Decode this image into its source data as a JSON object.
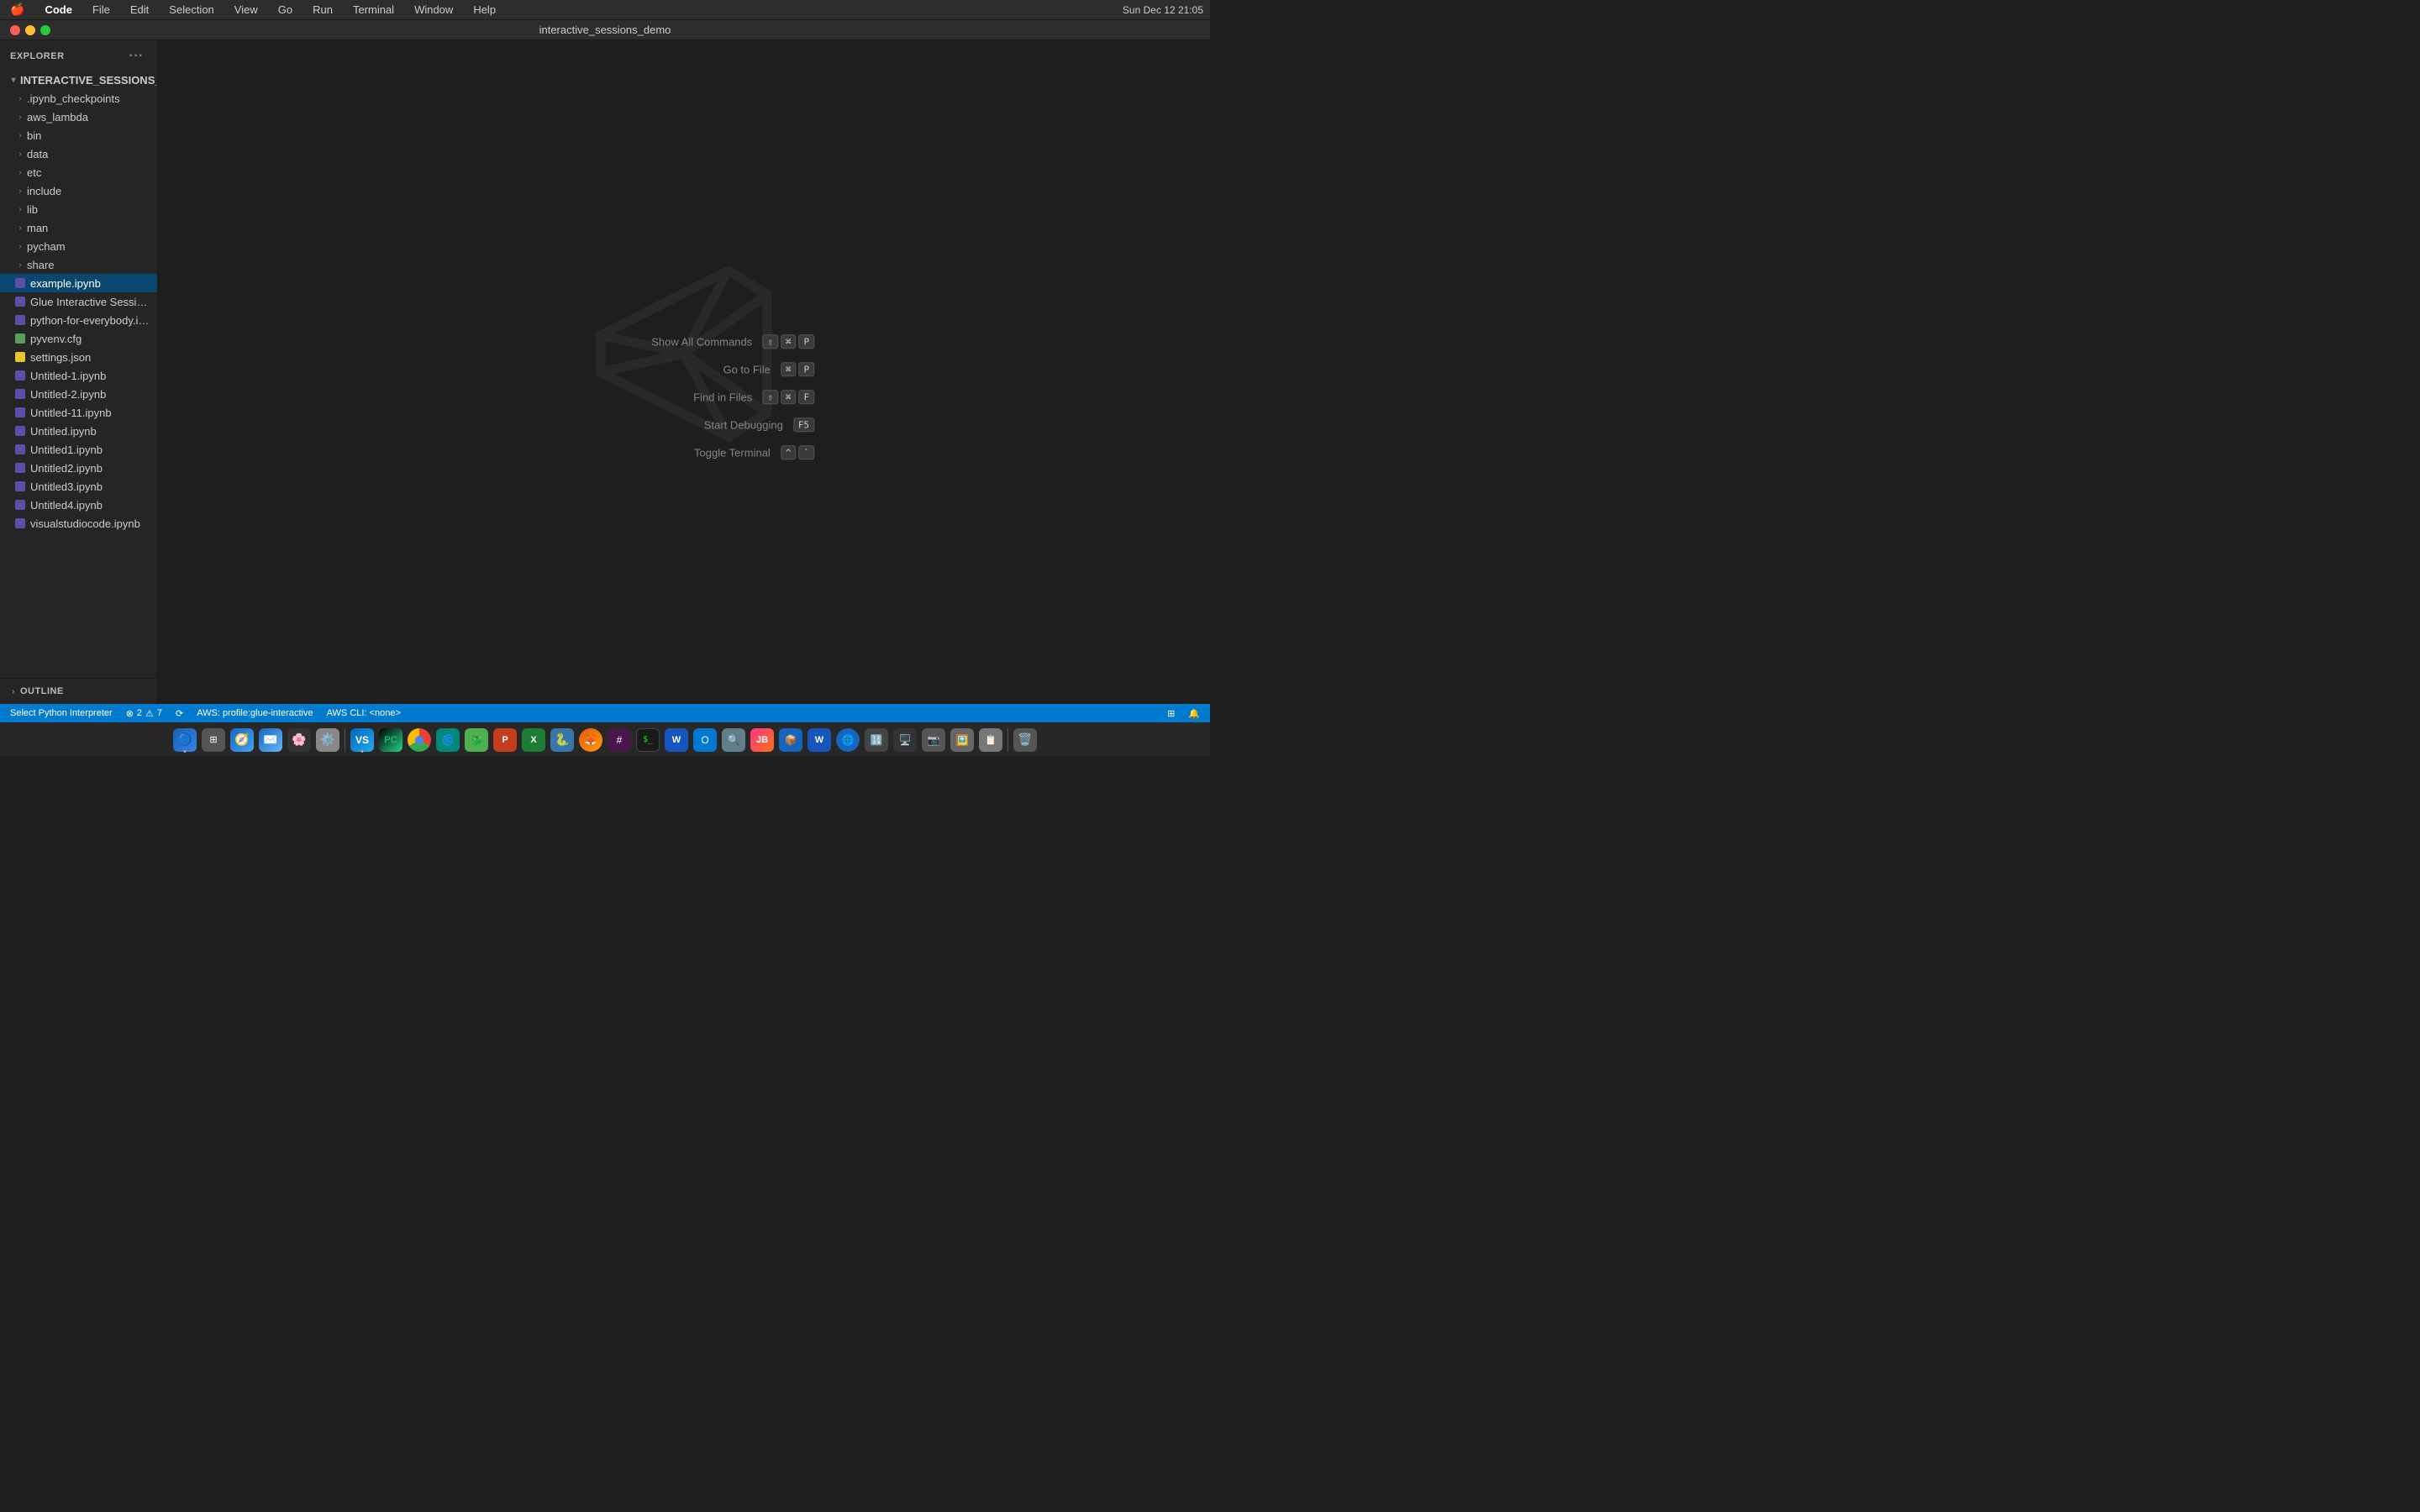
{
  "menubar": {
    "apple": "🍎",
    "items": [
      "Code",
      "File",
      "Edit",
      "Selection",
      "View",
      "Go",
      "Run",
      "Terminal",
      "Window",
      "Help"
    ],
    "time": "Sun Dec 12  21:05"
  },
  "titlebar": {
    "title": "interactive_sessions_demo"
  },
  "sidebar": {
    "header": "EXPLORER",
    "more_label": "···",
    "root": {
      "label": "INTERACTIVE_SESSIONS_DEMO",
      "expanded": true
    },
    "folders": [
      {
        "label": ".ipynb_checkpoints",
        "indent": 1
      },
      {
        "label": "aws_lambda",
        "indent": 1
      },
      {
        "label": "bin",
        "indent": 1
      },
      {
        "label": "data",
        "indent": 1
      },
      {
        "label": "etc",
        "indent": 1
      },
      {
        "label": "include",
        "indent": 1
      },
      {
        "label": "lib",
        "indent": 1
      },
      {
        "label": "man",
        "indent": 1
      },
      {
        "label": "pycham",
        "indent": 1
      },
      {
        "label": "share",
        "indent": 1
      }
    ],
    "files": [
      {
        "label": "example.ipynb",
        "type": "notebook",
        "active": true
      },
      {
        "label": "Glue Interactive Session.ipynb",
        "type": "notebook"
      },
      {
        "label": "python-for-everybody.ipynb",
        "type": "notebook"
      },
      {
        "label": "pyvenv.cfg",
        "type": "cfg"
      },
      {
        "label": "settings.json",
        "type": "json"
      },
      {
        "label": "Untitled-1.ipynb",
        "type": "notebook"
      },
      {
        "label": "Untitled-2.ipynb",
        "type": "notebook"
      },
      {
        "label": "Untitled-11.ipynb",
        "type": "notebook"
      },
      {
        "label": "Untitled.ipynb",
        "type": "notebook"
      },
      {
        "label": "Untitled1.ipynb",
        "type": "notebook"
      },
      {
        "label": "Untitled2.ipynb",
        "type": "notebook"
      },
      {
        "label": "Untitled3.ipynb",
        "type": "notebook"
      },
      {
        "label": "Untitled4.ipynb",
        "type": "notebook"
      },
      {
        "label": "visualstudiocode.ipynb",
        "type": "notebook"
      }
    ],
    "outline_label": "OUTLINE"
  },
  "commands": [
    {
      "label": "Show All Commands",
      "keys": [
        "⇧",
        "⌘",
        "P"
      ]
    },
    {
      "label": "Go to File",
      "keys": [
        "⌘",
        "P"
      ]
    },
    {
      "label": "Find in Files",
      "keys": [
        "⇧",
        "⌘",
        "F"
      ]
    },
    {
      "label": "Start Debugging",
      "keys": [
        "F5"
      ]
    },
    {
      "label": "Toggle Terminal",
      "keys": [
        "^",
        "`"
      ]
    }
  ],
  "statusbar": {
    "python_interpreter": "Select Python Interpreter",
    "errors": "2",
    "warnings": "7",
    "aws_profile": "AWS: profile:glue-interactive",
    "aws_cli": "AWS CLI: <none>",
    "branch_icon": "⎇"
  },
  "dock": {
    "items": [
      {
        "name": "finder",
        "emoji": "🟦",
        "color": "#1e7cf5"
      },
      {
        "name": "launchpad",
        "emoji": "🔲",
        "color": "#888"
      },
      {
        "name": "safari",
        "emoji": "🧭",
        "color": "#1e88e5"
      },
      {
        "name": "mail",
        "emoji": "✉️",
        "color": "#2196f3"
      },
      {
        "name": "photos",
        "emoji": "🖼️",
        "color": "#999"
      },
      {
        "name": "system-prefs",
        "emoji": "⚙️",
        "color": "#888"
      },
      {
        "name": "vscode",
        "emoji": "📘",
        "color": "#23a9f2"
      },
      {
        "name": "pycharm",
        "emoji": "🐍",
        "color": "#21d789"
      },
      {
        "name": "chrome",
        "emoji": "🟡",
        "color": "#fbbc04"
      },
      {
        "name": "unknown1",
        "emoji": "🔷",
        "color": "#2196f3"
      },
      {
        "name": "unknown2",
        "emoji": "🟩",
        "color": "#4caf50"
      },
      {
        "name": "powerpoint",
        "emoji": "📊",
        "color": "#d04b24"
      },
      {
        "name": "excel",
        "emoji": "📗",
        "color": "#1e7c34"
      },
      {
        "name": "unknown3",
        "emoji": "🐉",
        "color": "#888"
      },
      {
        "name": "firefox",
        "emoji": "🦊",
        "color": "#e55b15"
      },
      {
        "name": "slack",
        "emoji": "💬",
        "color": "#4a154b"
      },
      {
        "name": "terminal",
        "emoji": "⬛",
        "color": "#333"
      },
      {
        "name": "word",
        "emoji": "📝",
        "color": "#1755be"
      },
      {
        "name": "outlook",
        "emoji": "📧",
        "color": "#0078d4"
      },
      {
        "name": "finder2",
        "emoji": "🔍",
        "color": "#888"
      },
      {
        "name": "jetbrains",
        "emoji": "🟣",
        "color": "#9c27b0"
      },
      {
        "name": "virtualbox",
        "emoji": "📦",
        "color": "#1e88e5"
      },
      {
        "name": "word2",
        "emoji": "📄",
        "color": "#1755be"
      },
      {
        "name": "safari2",
        "emoji": "🌐",
        "color": "#1e88e5"
      },
      {
        "name": "calculator",
        "emoji": "🔢",
        "color": "#555"
      },
      {
        "name": "unknown4",
        "emoji": "🖥️",
        "color": "#888"
      },
      {
        "name": "unknown5",
        "emoji": "📷",
        "color": "#555"
      },
      {
        "name": "unknown6",
        "emoji": "🖼️",
        "color": "#888"
      },
      {
        "name": "unknown7",
        "emoji": "📋",
        "color": "#888"
      },
      {
        "name": "trash",
        "emoji": "🗑️",
        "color": "#888"
      }
    ]
  }
}
